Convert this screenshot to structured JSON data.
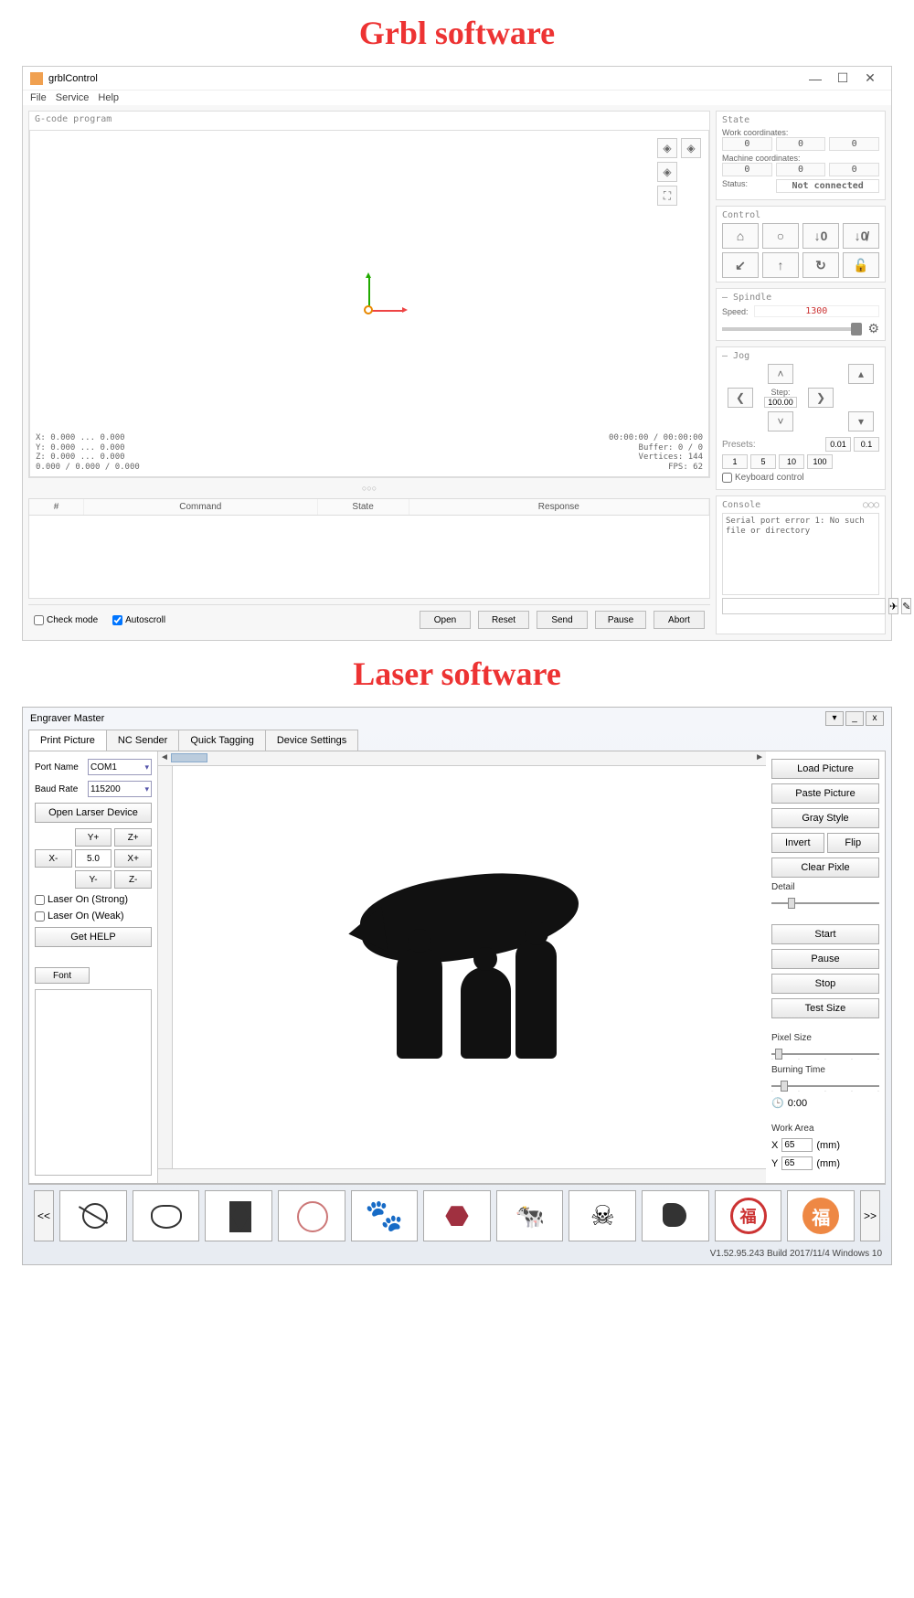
{
  "headings": {
    "grbl": "Grbl software",
    "laser": "Laser software"
  },
  "grbl": {
    "title": "grblControl",
    "menus": [
      "File",
      "Service",
      "Help"
    ],
    "gcode_label": "G-code program",
    "coords_bl": "X: 0.000 ... 0.000\nY: 0.000 ... 0.000\nZ: 0.000 ... 0.000\n0.000 / 0.000 / 0.000",
    "coords_br": "00:00:00 / 00:00:00\nBuffer: 0 / 0\nVertices: 144\nFPS: 62",
    "table_headers": {
      "n": "#",
      "cmd": "Command",
      "state": "State",
      "resp": "Response"
    },
    "check_mode": "Check mode",
    "autoscroll": "Autoscroll",
    "buttons": {
      "open": "Open",
      "reset": "Reset",
      "send": "Send",
      "pause": "Pause",
      "abort": "Abort"
    },
    "state": {
      "title": "State",
      "work_label": "Work coordinates:",
      "work": [
        "0",
        "0",
        "0"
      ],
      "machine_label": "Machine coordinates:",
      "machine": [
        "0",
        "0",
        "0"
      ],
      "status_label": "Status:",
      "status": "Not connected"
    },
    "control": {
      "title": "Control"
    },
    "spindle": {
      "title": "Spindle",
      "speed_label": "Speed:",
      "speed": "1300"
    },
    "jog": {
      "title": "Jog",
      "step_label": "Step:",
      "step": "100.00"
    },
    "presets": {
      "label": "Presets:",
      "vals": [
        "0.01",
        "0.1",
        "1",
        "5",
        "10",
        "100"
      ]
    },
    "keyboard": "Keyboard control",
    "console": {
      "title": "Console",
      "text": "Serial port error 1: No such file or directory"
    }
  },
  "em": {
    "title": "Engraver Master",
    "tabs": [
      "Print Picture",
      "NC Sender",
      "Quick Tagging",
      "Device Settings"
    ],
    "port_label": "Port Name",
    "port": "COM1",
    "baud_label": "Baud Rate",
    "baud": "115200",
    "open_device": "Open Larser Device",
    "jog": {
      "yp": "Y+",
      "zp": "Z+",
      "xm": "X-",
      "val": "5.0",
      "xp": "X+",
      "ym": "Y-",
      "zm": "Z-"
    },
    "laser_strong": "Laser On (Strong)",
    "laser_weak": "Laser On (Weak)",
    "help": "Get HELP",
    "font": "Font",
    "right": {
      "load": "Load Picture",
      "paste": "Paste Picture",
      "gray": "Gray Style",
      "invert": "Invert",
      "flip": "Flip",
      "clear": "Clear Pixle",
      "detail": "Detail",
      "start": "Start",
      "pause": "Pause",
      "stop": "Stop",
      "test": "Test Size",
      "pixel": "Pixel Size",
      "burn": "Burning Time",
      "time": "0:00",
      "work_area": "Work Area",
      "x": "65",
      "y": "65",
      "unit": "(mm)"
    },
    "status": "V1.52.95.243 Build 2017/11/4 Windows 10"
  }
}
